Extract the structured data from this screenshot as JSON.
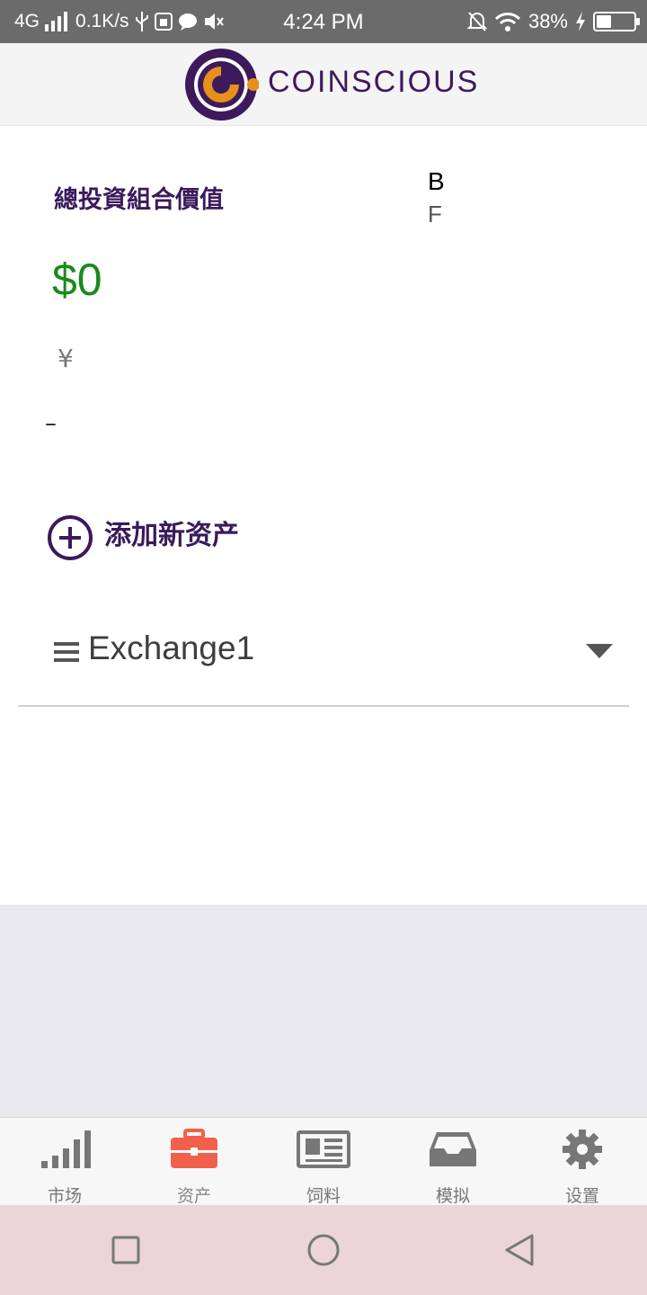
{
  "status_bar": {
    "network": "4G",
    "speed": "0.1K/s",
    "time": "4:24 PM",
    "battery": "38%",
    "icons": [
      "signal-icon",
      "usb-icon",
      "bug-icon",
      "chat-icon",
      "mute-icon",
      "bell-off-icon",
      "wifi-icon",
      "charging-icon",
      "battery-icon"
    ]
  },
  "header": {
    "brand": "COINSCIOUS",
    "colors": {
      "primary": "#3d1a5b",
      "accent": "#e8901c"
    }
  },
  "portfolio": {
    "label": "總投資組合價值",
    "side_top": "B",
    "side_bottom": "F",
    "total_value": "$0",
    "currency_symbol": "¥",
    "change": "–",
    "value_color": "#1a8a1a"
  },
  "add_asset": {
    "label": "添加新资产",
    "icon": "add-circle-icon"
  },
  "exchange": {
    "name": "Exchange1",
    "icon": "menu-icon",
    "toggle_icon": "caret-down-icon"
  },
  "tabs": [
    {
      "label": "市场",
      "icon": "bar-signal-icon",
      "active": false
    },
    {
      "label": "资产",
      "icon": "briefcase-icon",
      "active": true
    },
    {
      "label": "饲料",
      "icon": "newspaper-icon",
      "active": false
    },
    {
      "label": "模拟",
      "icon": "inbox-icon",
      "active": false
    },
    {
      "label": "设置",
      "icon": "gear-icon",
      "active": false
    }
  ],
  "active_tab_color": "#f2604b",
  "nav": {
    "icons": [
      "recent-apps-icon",
      "home-icon",
      "back-icon"
    ]
  }
}
